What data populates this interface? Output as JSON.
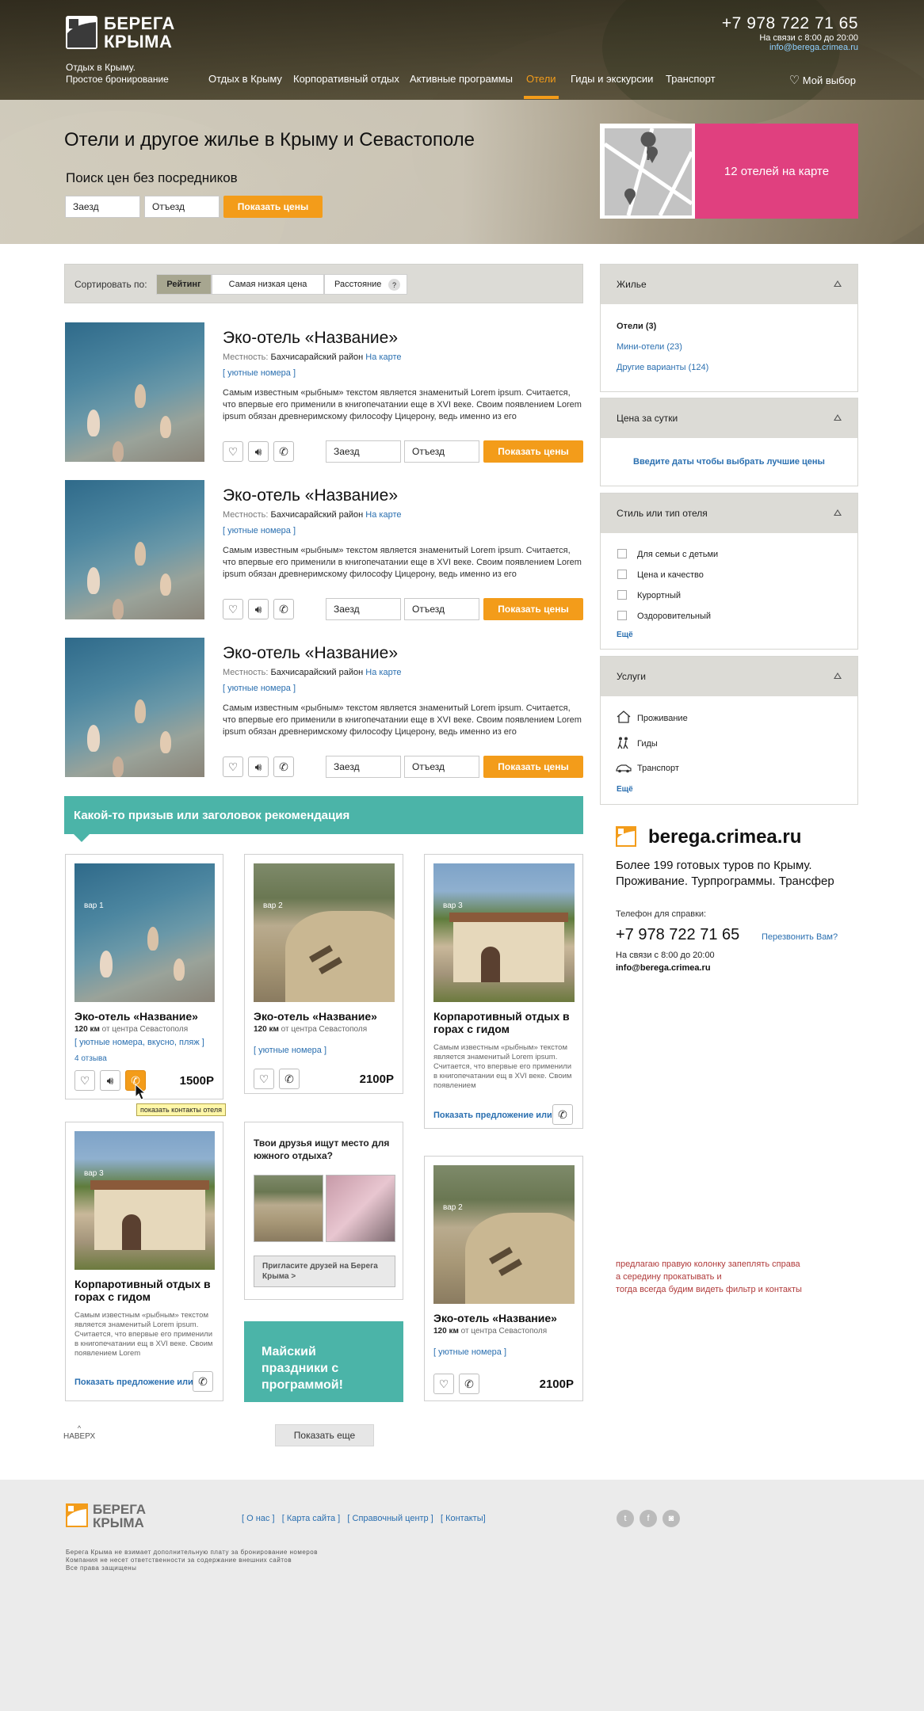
{
  "header": {
    "logo_line1": "БЕРЕГА",
    "logo_line2": "КРЫМА",
    "tagline1": "Отдых в Крыму.",
    "tagline2": "Простое бронирование",
    "phone": "+7 978 722 71 65",
    "hours": "На связи с 8:00 до 20:00",
    "email": "info@berega.crimea.ru",
    "my_choice": "Мой выбор",
    "nav": [
      "Отдых в Крыму",
      "Корпоративный отдых",
      "Активные программы",
      "Отели",
      "Гиды и экскурсии",
      "Транспорт"
    ],
    "nav_active_index": 3
  },
  "hero": {
    "title": "Отели и другое жилье в Крыму и Севастополе",
    "search_title": "Поиск цен без посредников",
    "checkin_value": "Заезд",
    "checkout_value": "Отъезд",
    "show_prices": "Показать цены",
    "map_label": "12 отелей на карте"
  },
  "sort": {
    "label": "Сортировать по:",
    "options": [
      "Рейтинг",
      "Самая низкая цена",
      "Расстояние"
    ],
    "help": "?",
    "active_index": 0
  },
  "hotels": [
    {
      "title": "Эко-отель «Название»",
      "locality_label": "Местность:",
      "locality": "Бахчисарайский район",
      "map_link": "На карте",
      "rooms_link": "[ уютные номера ]",
      "desc": "Самым известным «рыбным» текстом является знаменитый Lorem ipsum. Считается, что впервые его применили в книгопечатании еще в XVI веке. Своим появлением Lorem ipsum обязан древнеримскому философу Цицерону, ведь именно из его",
      "checkin": "Заезд",
      "checkout": "Отъезд",
      "show_prices": "Показать цены"
    },
    {
      "title": "Эко-отель «Название»",
      "locality_label": "Местность:",
      "locality": "Бахчисарайский район",
      "map_link": "На карте",
      "rooms_link": "[ уютные номера ]",
      "desc": "Самым известным «рыбным» текстом является знаменитый Lorem ipsum. Считается, что впервые его применили в книгопечатании еще в XVI веке. Своим появлением Lorem ipsum обязан древнеримскому философу Цицерону, ведь именно из его",
      "checkin": "Заезд",
      "checkout": "Отъезд",
      "show_prices": "Показать цены"
    },
    {
      "title": "Эко-отель «Название»",
      "locality_label": "Местность:",
      "locality": "Бахчисарайский район",
      "map_link": "На карте",
      "rooms_link": "[ уютные номера ]",
      "desc": "Самым известным «рыбным» текстом является знаменитый Lorem ipsum. Считается, что впервые его применили в книгопечатании еще в XVI веке. Своим появлением Lorem ipsum обязан древнеримскому философу Цицерону, ведь именно из его",
      "checkin": "Заезд",
      "checkout": "Отъезд",
      "show_prices": "Показать цены"
    }
  ],
  "recommend": {
    "banner": "Какой-то призыв или заголовок рекомендация",
    "card1": {
      "var": "вар 1",
      "title": "Эко-отель «Название»",
      "dist_num": "120 км",
      "dist_rest": "от центра Севастополя",
      "tags": "[ уютные номера, вкусно, пляж ]",
      "reviews": "4 отзыва",
      "price": "1500Р",
      "tooltip": "показать контакты отеля"
    },
    "card2": {
      "var": "вар 2",
      "title": "Эко-отель «Название»",
      "dist_num": "120 км",
      "dist_rest": "от центра Севастополя",
      "tags": "[ уютные номера ]",
      "price": "2100Р"
    },
    "card3": {
      "var": "вар 3",
      "title": "Корпаротивный отдых в горах с гидом",
      "desc": "Самым известным «рыбным» текстом является знаменитый Lorem ipsum. Считается, что впервые его применили в книгопечатании ещ в XVI веке. Своим появлением",
      "offer": "Показать предложение или"
    },
    "card4": {
      "var": "вар 3",
      "title": "Корпаротивный отдых в горах с гидом",
      "desc": "Самым известным «рыбным» текстом является знаменитый Lorem ipsum. Считается, что впервые его применили в книгопечатании ещ в XVI веке. Своим появлением Lorem",
      "offer": "Показать предложение или"
    },
    "friends": {
      "title": "Твои друзья ищут место для южного отдыха?",
      "invite": "Пригласите друзей на Берега Крыма >"
    },
    "promo": "Майский праздники с программой!",
    "card6": {
      "var": "вар 2",
      "title": "Эко-отель «Название»",
      "dist_num": "120 км",
      "dist_rest": "от центра Севастополя",
      "tags": "[ уютные номера ]",
      "price": "2100Р"
    }
  },
  "bottom": {
    "up": "НАВЕРХ",
    "up_arrow": "^",
    "show_more": "Показать еще"
  },
  "sidebar": {
    "housing": {
      "title": "Жилье",
      "items": [
        "Отели (3)",
        "Мини-отели (23)",
        "Другие варианты (124)"
      ]
    },
    "price": {
      "title": "Цена за сутки",
      "hint": "Введите даты чтобы выбрать лучшие цены"
    },
    "style": {
      "title": "Стиль или тип отеля",
      "items": [
        "Для семьи с детьми",
        "Цена и качество",
        "Курортный",
        "Оздоровительный"
      ],
      "more": "Ещё"
    },
    "services": {
      "title": "Услуги",
      "items": [
        "Проживание",
        "Гиды",
        "Транспорт"
      ],
      "more": "Ещё"
    },
    "promo": {
      "domain": "berega.crimea.ru",
      "tagline": "Более 199 готовых туров по Крыму. Проживание. Турпрограммы. Трансфер",
      "phone_label": "Телефон для справки:",
      "phone": "+7 978 722 71 65",
      "callback": "Перезвонить Вам?",
      "hours": "На связи с 8:00 до 20:00",
      "email": "info@berega.crimea.ru"
    },
    "note": "предлагаю правую колонку запеплять справа\nа середину прокатывать и\nтогда всегда будим видеть фильтр и контакты"
  },
  "footer": {
    "logo_line1": "БЕРЕГА",
    "logo_line2": "КРЫМА",
    "links": [
      "[ О нас ]",
      "[ Карта сайта ]",
      "[ Справочный центр ]",
      "[ Контакты]"
    ],
    "note1": "Берега Крыма не взимает дополнительную плату за бронирование номеров",
    "note2": "Компания не несет ответственности за содержание внешних сайтов",
    "note3": "Все права защищены",
    "social": [
      "twitter-icon",
      "facebook-icon",
      "instagram-icon"
    ]
  },
  "colors": {
    "accent": "#f39c1a",
    "teal": "#4bb4a8",
    "pink": "#e0407f",
    "link": "#2a6fb0"
  }
}
